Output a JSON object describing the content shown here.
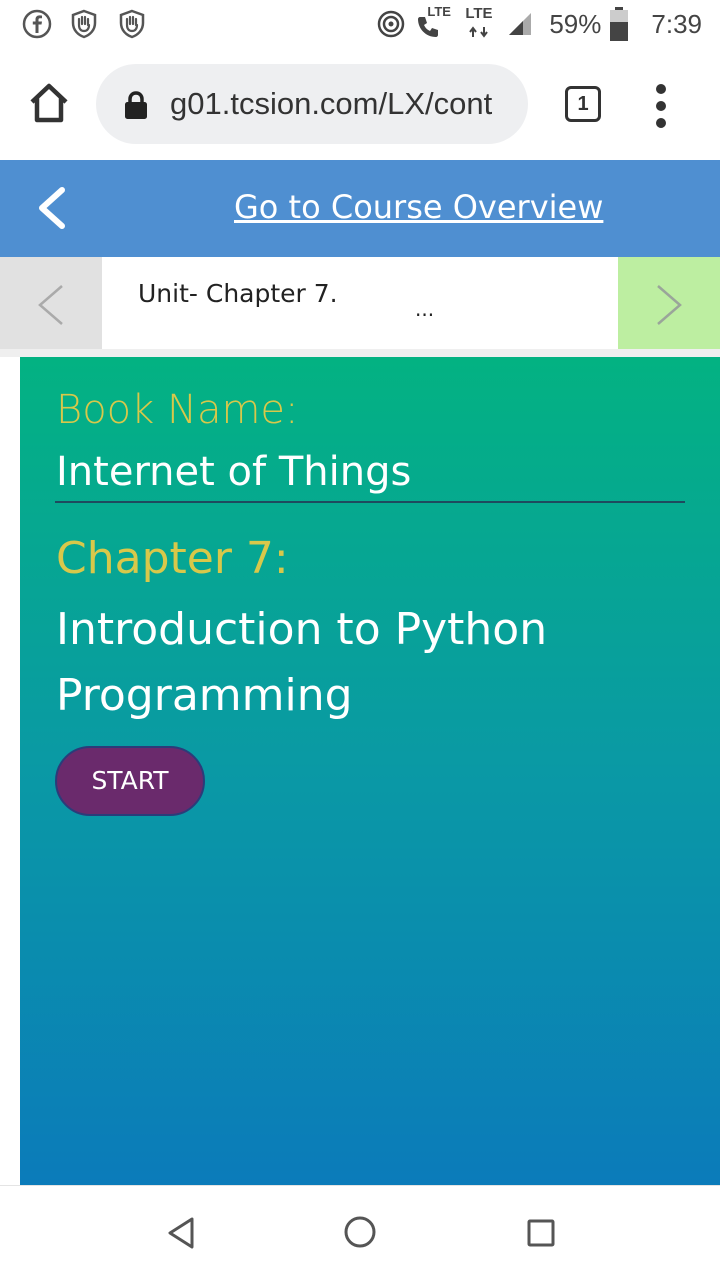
{
  "status_bar": {
    "lte_call": "LTE",
    "lte_data": "LTE",
    "battery": "59%",
    "time": "7:39",
    "icons": [
      "facebook-icon",
      "shield-hand-icon",
      "shield-hand-icon",
      "hotspot-icon",
      "wifi-calling-icon",
      "signal-icon",
      "battery-icon"
    ]
  },
  "browser": {
    "url": "g01.tcsion.com/LX/cont",
    "tab_count": "1",
    "icons": [
      "home-icon",
      "lock-icon",
      "more-vert-icon"
    ]
  },
  "course_header": {
    "link_label": "Go to Course Overview",
    "background": "#4f8fd1"
  },
  "unit_nav": {
    "title": "Unit- Chapter 7.",
    "more": "...",
    "next_color": "#bdeea1",
    "prev_color": "#e1e1e1"
  },
  "content": {
    "book_label": "Book Name:",
    "book_name": "Internet of Things",
    "chapter_label": "Chapter 7:",
    "chapter_title": "Introduction to Python Programming",
    "start_label": "START",
    "accent": "#d8c84a",
    "button_color": "#6a2a6c"
  },
  "system_nav": {
    "icons": [
      "back-triangle-icon",
      "home-circle-icon",
      "recents-square-icon"
    ]
  }
}
